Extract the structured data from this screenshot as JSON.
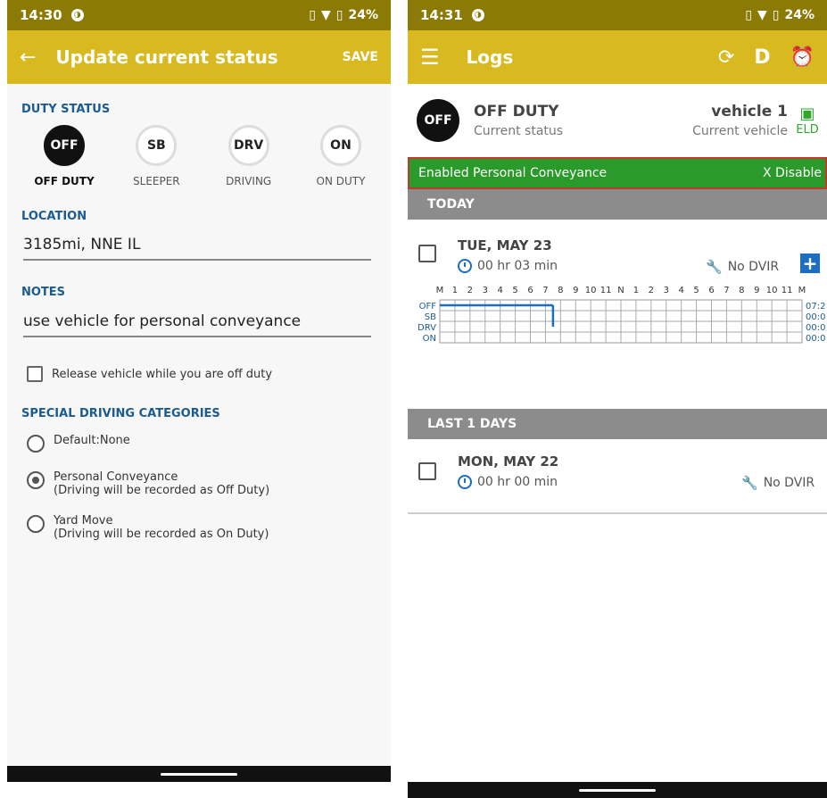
{
  "left": {
    "status_bar": {
      "time": "14:30",
      "battery": "24%"
    },
    "app_bar": {
      "title": "Update current status",
      "save": "SAVE"
    },
    "duty_status": {
      "heading": "DUTY STATUS",
      "items": [
        {
          "code": "OFF",
          "label": "OFF DUTY",
          "active": true
        },
        {
          "code": "SB",
          "label": "SLEEPER",
          "active": false
        },
        {
          "code": "DRV",
          "label": "DRIVING",
          "active": false
        },
        {
          "code": "ON",
          "label": "ON DUTY",
          "active": false
        }
      ]
    },
    "location": {
      "heading": "LOCATION",
      "value": "3185mi, NNE IL"
    },
    "notes": {
      "heading": "NOTES",
      "value": "use vehicle for personal conveyance"
    },
    "release_checkbox": {
      "label": "Release vehicle while you are off duty",
      "checked": false
    },
    "special": {
      "heading": "SPECIAL DRIVING CATEGORIES",
      "options": [
        {
          "label": "Default:None",
          "sub": "",
          "selected": false
        },
        {
          "label": "Personal Conveyance",
          "sub": "(Driving will be recorded as Off Duty)",
          "selected": true
        },
        {
          "label": "Yard Move",
          "sub": "(Driving will be recorded as On Duty)",
          "selected": false
        }
      ]
    }
  },
  "right": {
    "status_bar": {
      "time": "14:31",
      "battery": "24%"
    },
    "app_bar": {
      "title": "Logs",
      "d_label": "D"
    },
    "current": {
      "badge": "OFF",
      "status": "OFF DUTY",
      "status_sub": "Current status",
      "vehicle": "vehicle 1",
      "vehicle_sub": "Current vehicle",
      "eld": "ELD"
    },
    "pc_banner": {
      "text": "Enabled Personal Conveyance",
      "action": "X Disable"
    },
    "today_header": "TODAY",
    "today": {
      "date": "TUE, MAY 23",
      "duration": "00 hr  03 min",
      "dvir": "No DVIR",
      "hour_labels": [
        "M",
        "1",
        "2",
        "3",
        "4",
        "5",
        "6",
        "7",
        "8",
        "9",
        "10",
        "11",
        "N",
        "1",
        "2",
        "3",
        "4",
        "5",
        "6",
        "7",
        "8",
        "9",
        "10",
        "11",
        "M"
      ],
      "rows": [
        "OFF",
        "SB",
        "DRV",
        "ON"
      ],
      "totals": [
        "07:2",
        "00:0",
        "00:0",
        "00:0"
      ],
      "graph": {
        "off_until_hour": 7.5,
        "transition_to": "DRV"
      }
    },
    "last_header": "LAST 1 DAYS",
    "last_day": {
      "date": "MON, MAY 22",
      "duration": "00 hr  00 min",
      "dvir": "No DVIR"
    },
    "colors": {
      "brand": "#d8b91f",
      "status_bar": "#8c7a06",
      "accent": "#1b6ec2",
      "pc_green": "#2a9a2a",
      "eld_green": "#2ea82e"
    }
  }
}
